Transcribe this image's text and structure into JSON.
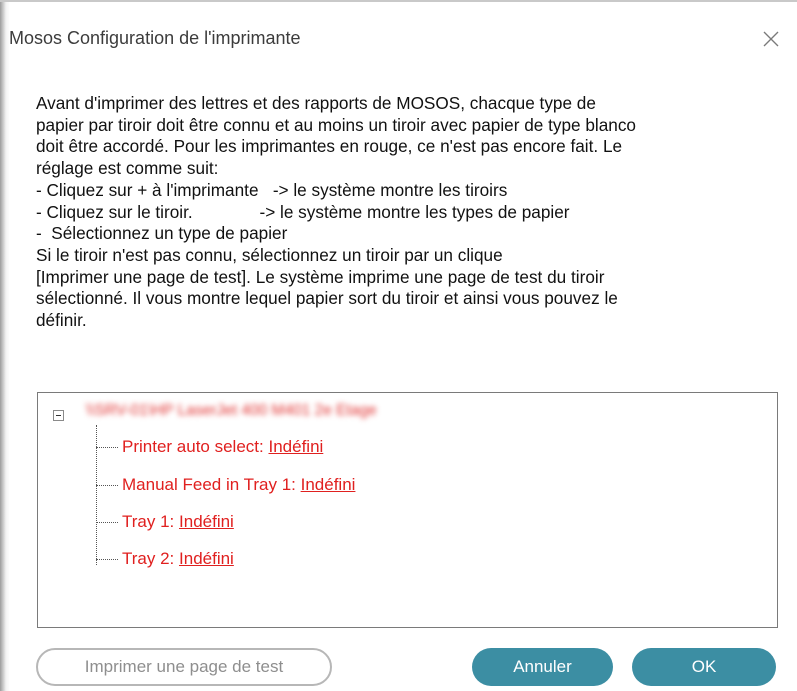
{
  "window": {
    "title": "Mosos Configuration de l'imprimante"
  },
  "intro": {
    "lines": [
      "Avant d'imprimer des lettres et des rapports de MOSOS, chacque type de",
      "papier par tiroir doit être connu et au moins un tiroir avec papier de type blanco",
      "doit être accordé. Pour les imprimantes en rouge, ce n'est pas encore fait. Le",
      "réglage est comme suit:",
      "- Cliquez sur + à l'imprimante   -> le système montre les tiroirs",
      "- Cliquez sur le tiroir.              -> le système montre les types de papier",
      "-  Sélectionnez un type de papier",
      "Si le tiroir n'est pas connu, sélectionnez un tiroir par un clique",
      "[Imprimer une page de test]. Le système imprime une page de test du tiroir",
      "sélectionné. Il vous montre lequel papier sort du tiroir et ainsi vous pouvez le",
      "définir."
    ]
  },
  "tree": {
    "printer_name": "\\\\SRV-01\\HP LaserJet 400 M401 2e Etage",
    "trays": [
      {
        "name": "Printer auto select:",
        "paper": "Indéfini"
      },
      {
        "name": "Manual Feed in Tray 1:",
        "paper": "Indéfini"
      },
      {
        "name": "Tray 1:",
        "paper": "Indéfini"
      },
      {
        "name": "Tray 2:",
        "paper": "Indéfini"
      }
    ]
  },
  "buttons": {
    "test_page": "Imprimer une page de test",
    "cancel": "Annuler",
    "ok": "OK"
  },
  "colors": {
    "accent": "#3c8ea3",
    "unconfigured_red": "#e0201f",
    "disabled_gray": "#8e8e8e"
  },
  "icons": {
    "close": "close-icon",
    "collapse": "minus-box-icon"
  }
}
